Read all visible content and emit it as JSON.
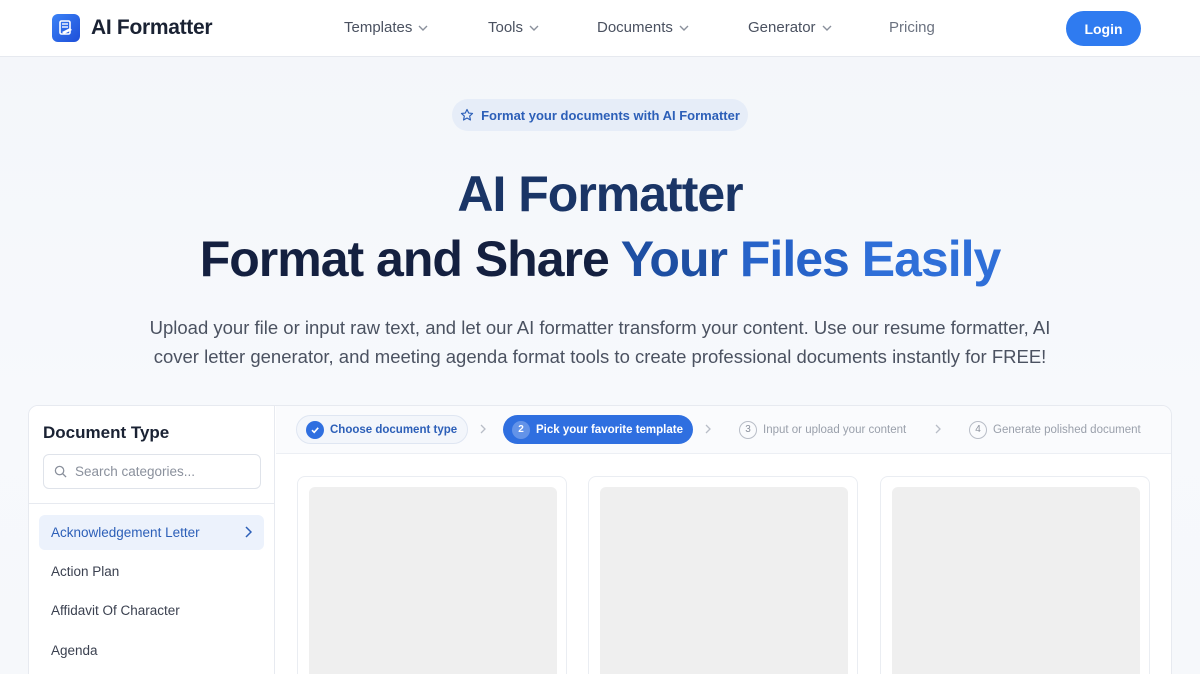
{
  "header": {
    "brand": "AI Formatter",
    "nav": [
      {
        "label": "Templates",
        "has_dropdown": true
      },
      {
        "label": "Tools",
        "has_dropdown": true
      },
      {
        "label": "Documents",
        "has_dropdown": true
      },
      {
        "label": "Generator",
        "has_dropdown": true
      },
      {
        "label": "Pricing",
        "has_dropdown": false
      }
    ],
    "login_label": "Login"
  },
  "hero": {
    "badge": "Format your documents with AI Formatter",
    "title": "AI Formatter",
    "subtitle_part1": "Format and Share",
    "subtitle_part2": "Your",
    "subtitle_part3": "Files",
    "subtitle_part4": "Easily",
    "description_line1": "Upload your file or input raw text, and let our AI formatter transform your content. Use our resume formatter, AI",
    "description_line2": "cover letter generator, and meeting agenda format tools to create professional documents instantly for FREE!"
  },
  "sidebar": {
    "title": "Document Type",
    "search_placeholder": "Search categories...",
    "items": [
      {
        "label": "Acknowledgement Letter",
        "active": true
      },
      {
        "label": "Action Plan",
        "active": false
      },
      {
        "label": "Affidavit Of Character",
        "active": false
      },
      {
        "label": "Agenda",
        "active": false
      }
    ]
  },
  "steps": [
    {
      "number": "1",
      "label": "Choose document type",
      "state": "done"
    },
    {
      "number": "2",
      "label": "Pick your favorite template",
      "state": "current"
    },
    {
      "number": "3",
      "label": "Input or upload your content",
      "state": "pending"
    },
    {
      "number": "4",
      "label": "Generate polished document",
      "state": "pending"
    }
  ],
  "colors": {
    "accent": "#2f7bf0",
    "title_dark": "#142040",
    "title_blue": "#2763c9",
    "active_bg": "#ecf2fc"
  }
}
